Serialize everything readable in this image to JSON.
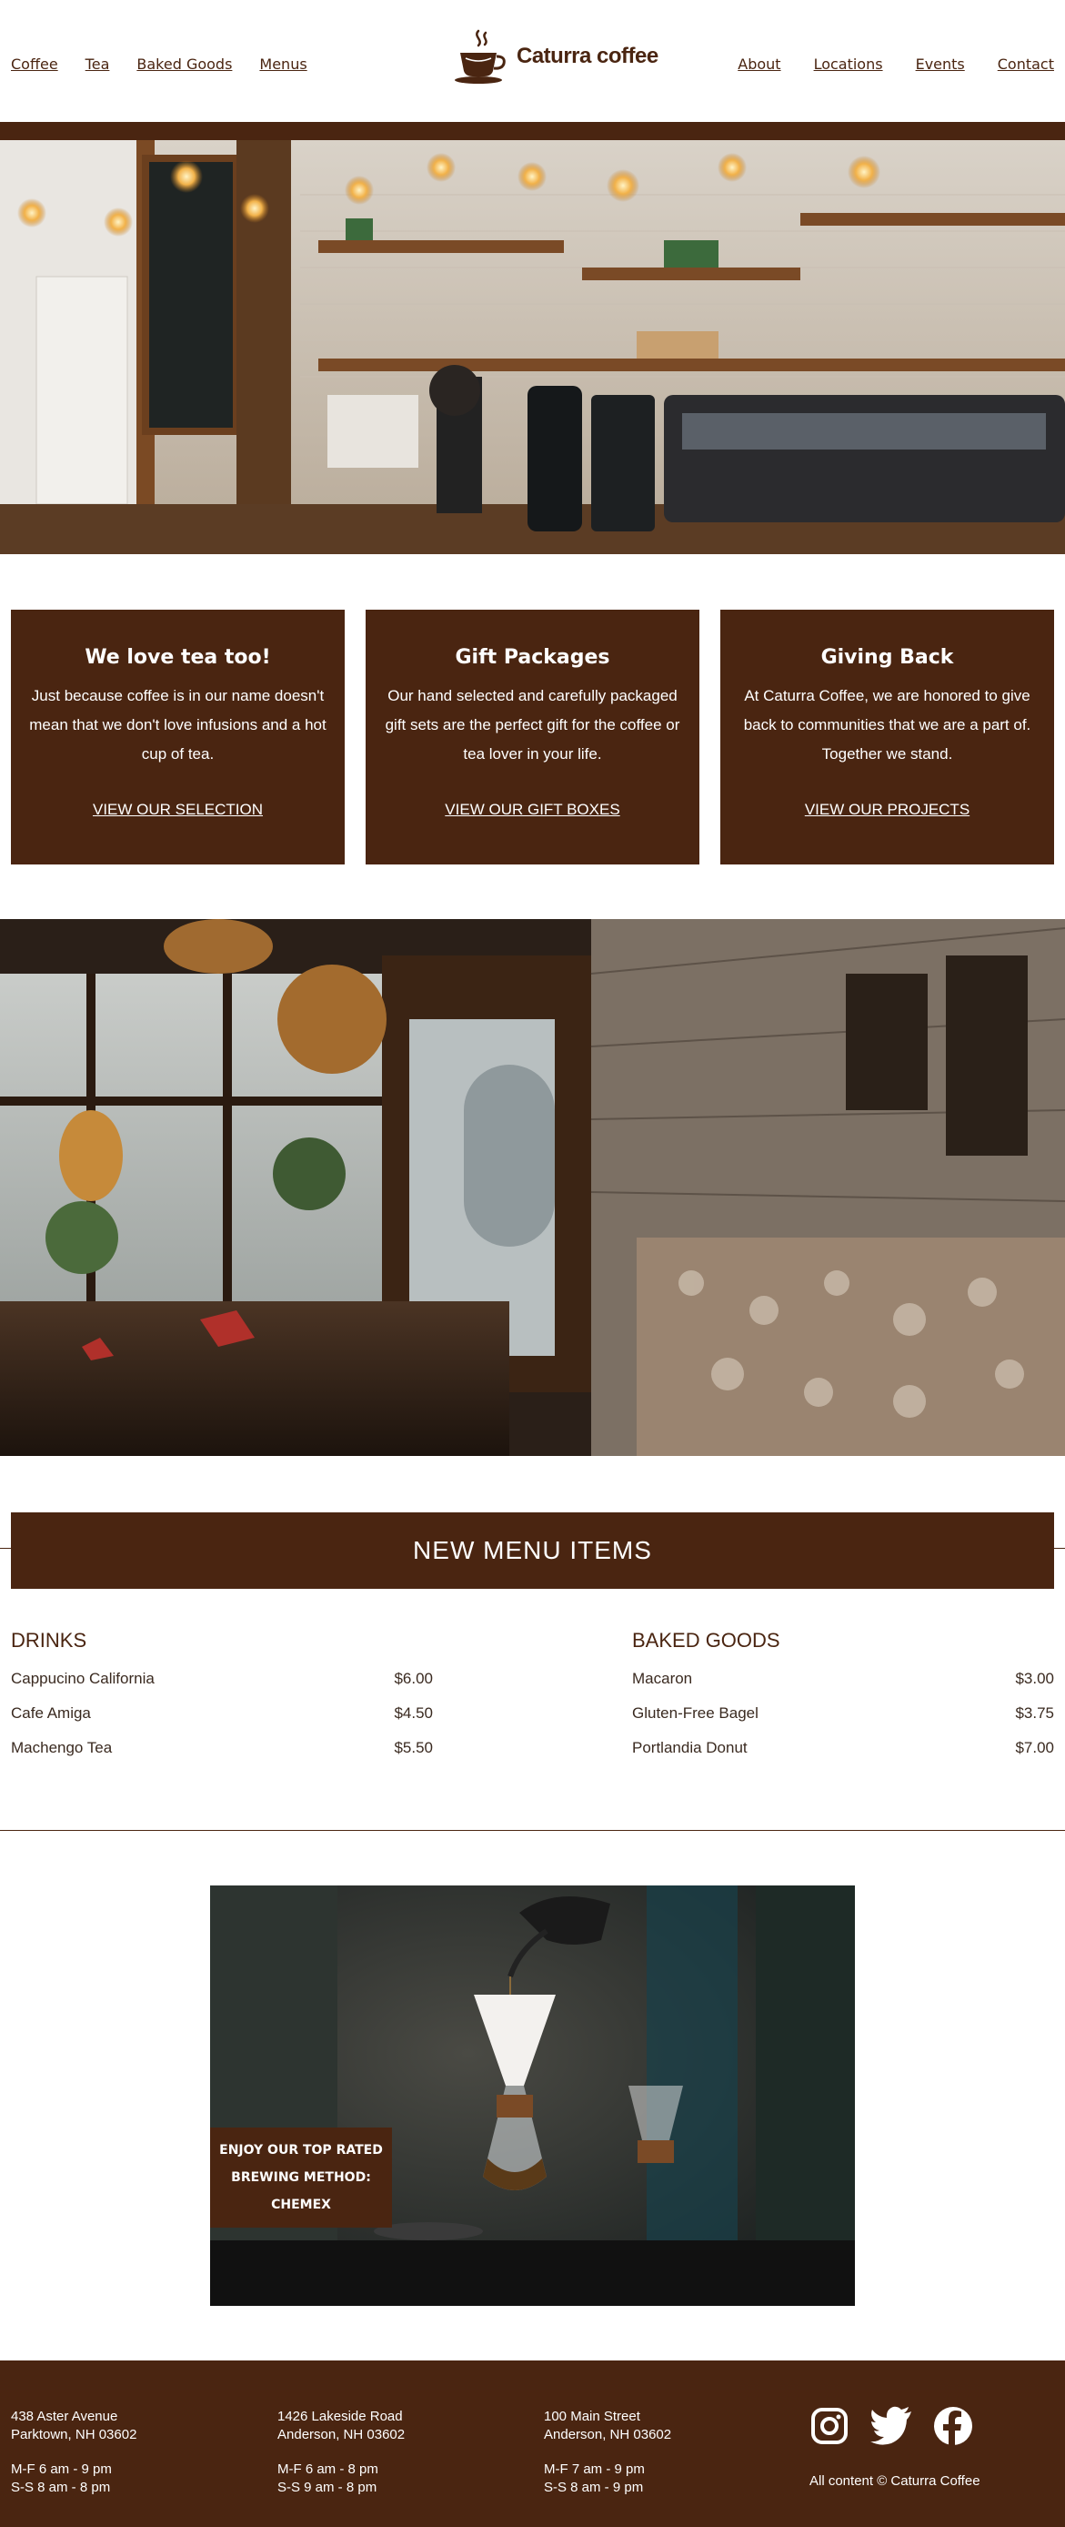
{
  "header": {
    "nav_left": [
      "Coffee",
      "Tea",
      "Baked Goods",
      "Menus"
    ],
    "nav_right": [
      "About",
      "Locations",
      "Events",
      "Contact"
    ],
    "logo_text": "Caturra coffee"
  },
  "cards": [
    {
      "title": "We love tea too!",
      "body": "Just because coffee is in our name doesn't mean that we don't love infusions and a hot cup of tea.",
      "link": "VIEW OUR SELECTION"
    },
    {
      "title": "Gift Packages",
      "body": "Our hand selected and carefully packaged gift sets are the perfect gift for the coffee or tea lover in your life.",
      "link": "VIEW OUR GIFT BOXES"
    },
    {
      "title": "Giving Back",
      "body": "At Caturra Coffee, we are honored to give back to communities that we are a part of. Together we stand.",
      "link": "VIEW OUR PROJECTS"
    }
  ],
  "menu": {
    "banner": "NEW MENU ITEMS",
    "drinks": {
      "heading": "DRINKS",
      "items": [
        {
          "name": "Cappucino California",
          "price": "$6.00"
        },
        {
          "name": "Cafe Amiga",
          "price": "$4.50"
        },
        {
          "name": "Machengo Tea",
          "price": "$5.50"
        }
      ]
    },
    "baked": {
      "heading": "BAKED GOODS",
      "items": [
        {
          "name": "Macaron",
          "price": "$3.00"
        },
        {
          "name": "Gluten-Free Bagel",
          "price": "$3.75"
        },
        {
          "name": "Portlandia Donut",
          "price": "$7.00"
        }
      ]
    }
  },
  "brew": {
    "line1": "ENJOY OUR TOP RATED",
    "line2": "BREWING METHOD:",
    "line3": "CHEMEX"
  },
  "footer": {
    "locations": [
      {
        "street": "438 Aster Avenue",
        "city": "Parktown, NH 03602",
        "weekday": "M-F 6 am - 9 pm",
        "weekend": "S-S 8 am - 8 pm"
      },
      {
        "street": "1426 Lakeside Road",
        "city": "Anderson, NH 03602",
        "weekday": "M-F 6 am - 8 pm",
        "weekend": "S-S 9 am - 8 pm"
      },
      {
        "street": "100 Main Street",
        "city": "Anderson, NH 03602",
        "weekday": "M-F 7 am - 9 pm",
        "weekend": "S-S 8 am - 9 pm"
      }
    ],
    "social_icons": [
      "instagram-icon",
      "twitter-icon",
      "facebook-icon"
    ],
    "copyright": "All content © Caturra Coffee"
  },
  "colors": {
    "brand_brown": "#4a2511",
    "text_dark": "#3a2a20",
    "white": "#ffffff"
  }
}
